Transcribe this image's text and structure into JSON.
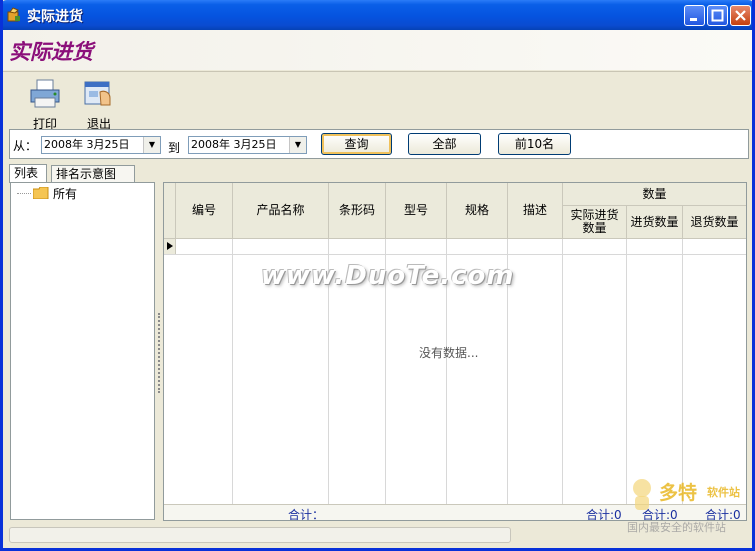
{
  "window": {
    "title": "实际进货"
  },
  "banner": {
    "title": "实际进货"
  },
  "toolbar": {
    "print_label": "打印",
    "exit_label": "退出"
  },
  "filter": {
    "from_label": "从：",
    "from_date": "2008年 3月25日",
    "to_label": "到",
    "to_date": "2008年 3月25日",
    "query_label": "查询",
    "all_label": "全部",
    "top10_label": "前10名"
  },
  "tabs": {
    "list": "列表",
    "ranking": "排名示意图"
  },
  "tree": {
    "root": "所有"
  },
  "grid": {
    "columns": {
      "code": "编号",
      "product_name": "产品名称",
      "barcode": "条形码",
      "model": "型号",
      "spec": "规格",
      "desc": "描述",
      "quantity_group": "数量",
      "actual_qty": "实际进货数量",
      "in_qty": "进货数量",
      "return_qty": "退货数量"
    },
    "empty_text": "没有数据...",
    "watermark": "www.DuoTe.com",
    "footer": {
      "total_label": "合计：",
      "actual_total": "合计:0",
      "in_total": "合计:0",
      "return_total": "合计:0"
    }
  },
  "logo": {
    "big": "多特",
    "small": "软件站",
    "sub": "国内最安全的软件站"
  },
  "colors": {
    "titlebar": "#0553df",
    "banner_title": "#8b0f7a",
    "window_bg": "#ece9d8"
  }
}
